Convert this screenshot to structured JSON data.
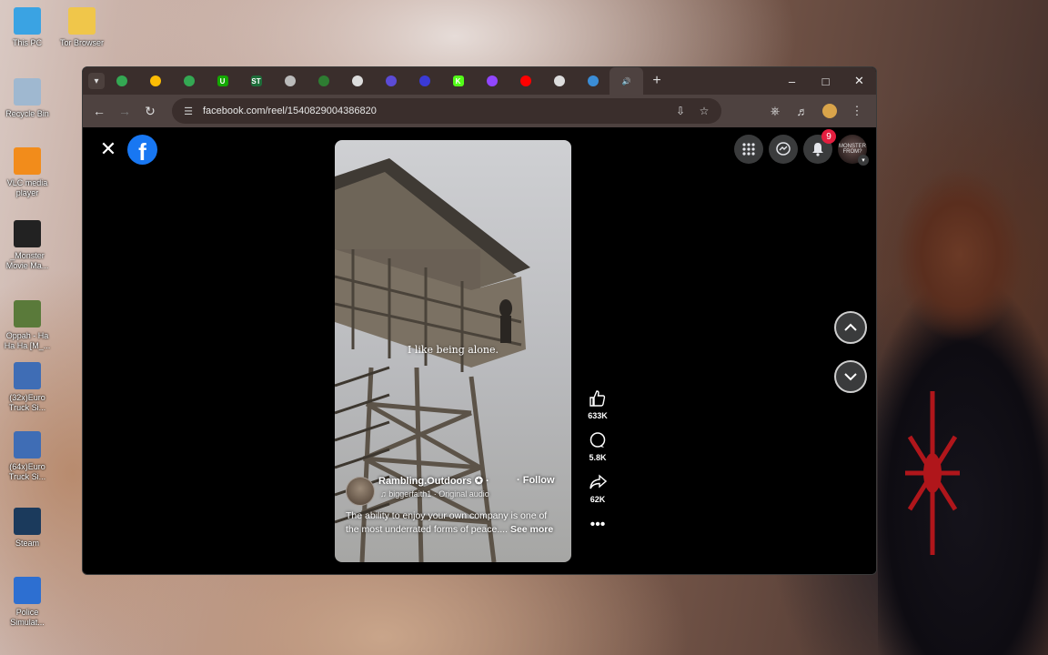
{
  "desktop": {
    "icons": [
      {
        "label": "This PC",
        "color": "#3aa3e3"
      },
      {
        "label": "Tor Browser",
        "color": "#f0c64a"
      },
      {
        "label": "Recycle Bin",
        "color": "#9fb8d0"
      },
      {
        "label": "VLC media player",
        "color": "#f28c1b"
      },
      {
        "label": "_Monster Movie Ma...",
        "color": "#222222"
      },
      {
        "label": "Oppah - Ha Ha Ha [M_...",
        "color": "#5a7a3a"
      },
      {
        "label": "(32x)Euro Truck Si...",
        "color": "#3f6db5"
      },
      {
        "label": "(64x)Euro Truck Si...",
        "color": "#3f6db5"
      },
      {
        "label": "Steam",
        "color": "#1b3a5c"
      },
      {
        "label": "Police Simulat...",
        "color": "#2d6fd1"
      }
    ]
  },
  "browser": {
    "tabs": [
      {
        "icon": "google-drive-icon",
        "color": "#34a853",
        "glyph": ""
      },
      {
        "icon": "google-drive-icon",
        "color": "#fbbc04",
        "glyph": ""
      },
      {
        "icon": "google-drive-icon",
        "color": "#34a853",
        "glyph": ""
      },
      {
        "icon": "upwork-icon",
        "color": "#14a800",
        "glyph": "U"
      },
      {
        "icon": "st-icon",
        "color": "#1e6e3a",
        "glyph": "ST"
      },
      {
        "icon": "globe-icon",
        "color": "#bbbbbb",
        "glyph": ""
      },
      {
        "icon": "grammar-icon",
        "color": "#2e7d32",
        "glyph": ""
      },
      {
        "icon": "image-icon",
        "color": "#dddddd",
        "glyph": ""
      },
      {
        "icon": "gem-icon",
        "color": "#5b4bd6",
        "glyph": ""
      },
      {
        "icon": "gem-icon",
        "color": "#3a3ad6",
        "glyph": ""
      },
      {
        "icon": "kick-icon",
        "color": "#53fc18",
        "glyph": "K"
      },
      {
        "icon": "twitch-icon",
        "color": "#9146ff",
        "glyph": ""
      },
      {
        "icon": "youtube-icon",
        "color": "#ff0000",
        "glyph": ""
      },
      {
        "icon": "sparkle-icon",
        "color": "#dddddd",
        "glyph": ""
      },
      {
        "icon": "search-tab-icon",
        "color": "#3b8dd6",
        "glyph": ""
      },
      {
        "icon": "audio-tab-icon",
        "color": "#dddddd",
        "glyph": "🔊",
        "active": true
      }
    ],
    "url": "facebook.com/reel/1540829004386820"
  },
  "reel": {
    "overlay_text": "I like being alone.",
    "author": "Rambling.Outdoors ✪ ·",
    "follow": "· Follow",
    "audio": "♫ biggerfaith1 · Original audio",
    "description": "The ability to enjoy your own company is one of the most underrated forms of peace....",
    "see_more": "See more",
    "likes": "633K",
    "comments": "5.8K",
    "shares": "62K"
  },
  "header": {
    "notification_count": "9",
    "avatar_text": "MONSTER FROM?"
  }
}
